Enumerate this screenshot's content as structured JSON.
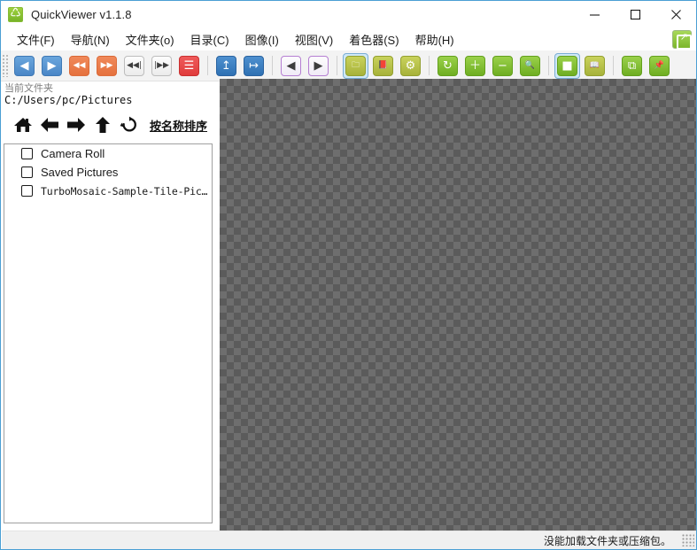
{
  "window": {
    "title": "QuickViewer v1.1.8",
    "app_icon": "recycle-green-icon",
    "minimize_label": "—",
    "maximize_label": "□",
    "close_label": "✕"
  },
  "menubar": {
    "items": [
      {
        "label": "文件(F)",
        "name": "menu-file"
      },
      {
        "label": "导航(N)",
        "name": "menu-navigation"
      },
      {
        "label": "文件夹(o)",
        "name": "menu-folder"
      },
      {
        "label": "目录(C)",
        "name": "menu-catalog"
      },
      {
        "label": "图像(I)",
        "name": "menu-image"
      },
      {
        "label": "视图(V)",
        "name": "menu-view"
      },
      {
        "label": "着色器(S)",
        "name": "menu-shader"
      },
      {
        "label": "帮助(H)",
        "name": "menu-help"
      }
    ],
    "right_button_icon": "open-external-green-icon"
  },
  "toolbar": {
    "buttons": [
      {
        "name": "prev-page-button",
        "icon": "triangle-left-icon",
        "glyph": "◀",
        "style": "ic-blue",
        "active": false
      },
      {
        "name": "next-page-button",
        "icon": "triangle-right-icon",
        "glyph": "▶",
        "style": "ic-blue",
        "active": false
      },
      {
        "name": "fast-rewind-button",
        "icon": "double-arrow-left-icon",
        "glyph": "◀◀",
        "style": "ic-orange",
        "active": false
      },
      {
        "name": "fast-forward-button",
        "icon": "double-arrow-right-icon",
        "glyph": "▶▶",
        "style": "ic-orange",
        "active": false
      },
      {
        "name": "first-page-button",
        "icon": "skip-to-start-icon",
        "glyph": "◀◀|",
        "style": "ic-white",
        "active": false
      },
      {
        "name": "last-page-button",
        "icon": "skip-to-end-icon",
        "glyph": "|▶▶",
        "style": "ic-white",
        "active": false
      },
      {
        "name": "toc-button",
        "icon": "list-lines-icon",
        "glyph": "☰",
        "style": "ic-red",
        "active": false
      },
      {
        "separator": true
      },
      {
        "name": "import-button",
        "icon": "arrow-up-into-box-icon",
        "glyph": "↥",
        "style": "ic-bluedk",
        "active": false
      },
      {
        "name": "export-button",
        "icon": "arrow-right-out-box-icon",
        "glyph": "↦",
        "style": "ic-bluedk",
        "active": false
      },
      {
        "separator": true
      },
      {
        "name": "page-back-button",
        "icon": "boxed-triangle-left-icon",
        "glyph": "◀",
        "style": "ic-purple",
        "active": false
      },
      {
        "name": "page-forward-button",
        "icon": "boxed-triangle-right-icon",
        "glyph": "▶",
        "style": "ic-purple",
        "active": false
      },
      {
        "separator": true
      },
      {
        "name": "open-folder-button",
        "icon": "folder-icon",
        "glyph": "🗀",
        "style": "ic-olive",
        "active": true
      },
      {
        "name": "open-book-button",
        "icon": "book-icon",
        "glyph": "📕",
        "style": "ic-olive",
        "active": false
      },
      {
        "name": "settings-button",
        "icon": "gear-icon",
        "glyph": "⚙",
        "style": "ic-olive",
        "active": false
      },
      {
        "separator": true
      },
      {
        "name": "rotate-button",
        "icon": "rotate-clockwise-icon",
        "glyph": "↻",
        "style": "ic-green",
        "active": false
      },
      {
        "name": "zoom-in-button",
        "icon": "plus-icon",
        "glyph": "＋",
        "style": "ic-green",
        "active": false
      },
      {
        "name": "zoom-out-button",
        "icon": "minus-icon",
        "glyph": "−",
        "style": "ic-green",
        "active": false
      },
      {
        "name": "zoom-fit-button",
        "icon": "magnifier-icon",
        "glyph": "🔍",
        "style": "ic-green",
        "active": false
      },
      {
        "separator": true
      },
      {
        "name": "single-page-view-button",
        "icon": "single-page-icon",
        "glyph": "■",
        "style": "ic-greenw",
        "active": true
      },
      {
        "name": "dual-page-view-button",
        "icon": "open-book-spread-icon",
        "glyph": "📖",
        "style": "ic-olive",
        "active": false
      },
      {
        "separator": true
      },
      {
        "name": "window-mode-button",
        "icon": "windows-stack-icon",
        "glyph": "⧉",
        "style": "ic-green",
        "active": false
      },
      {
        "name": "pin-on-top-button",
        "icon": "pushpin-icon",
        "glyph": "📌",
        "style": "ic-green",
        "active": false
      }
    ]
  },
  "sidebar": {
    "current_folder_label": "当前文件夹",
    "current_folder_path": "C:/Users/pc/Pictures",
    "nav": [
      {
        "name": "home-button",
        "icon": "home-icon"
      },
      {
        "name": "back-button",
        "icon": "arrow-left-icon"
      },
      {
        "name": "forward-button",
        "icon": "arrow-right-icon"
      },
      {
        "name": "up-button",
        "icon": "arrow-up-icon"
      },
      {
        "name": "refresh-button",
        "icon": "refresh-icon"
      }
    ],
    "sort_label": "按名称排序",
    "items": [
      {
        "label": "Camera Roll",
        "checked": false,
        "mono": false
      },
      {
        "label": "Saved Pictures",
        "checked": false,
        "mono": false
      },
      {
        "label": "TurboMosaic-Sample-Tile-Pic…",
        "checked": false,
        "mono": true
      }
    ]
  },
  "viewer": {
    "background": "transparent-checkerboard",
    "colors": {
      "light": "#6e6e6e",
      "dark": "#5b5b5b"
    }
  },
  "statusbar": {
    "message": "没能加载文件夹或压缩包。"
  }
}
